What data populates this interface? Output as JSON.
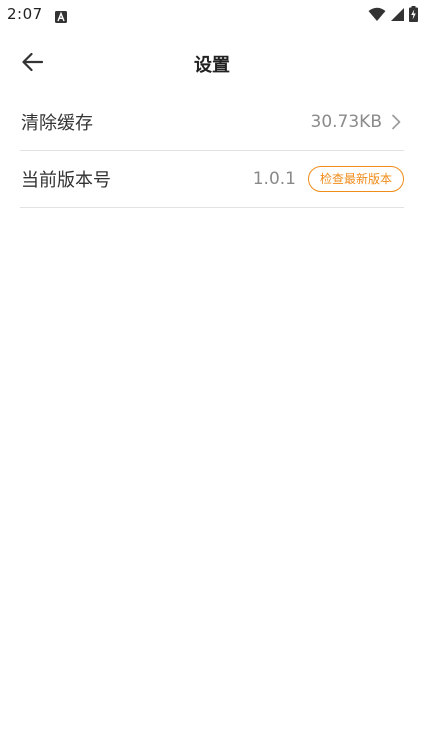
{
  "status_bar": {
    "time": "2:07",
    "icons": [
      "a-notification-icon",
      "wifi-icon",
      "signal-icon",
      "battery-charging-icon"
    ]
  },
  "header": {
    "title": "设置",
    "back_icon": "arrow-left-icon"
  },
  "settings": {
    "clear_cache": {
      "label": "清除缓存",
      "value": "30.73KB",
      "icon": "chevron-right-icon"
    },
    "version": {
      "label": "当前版本号",
      "value": "1.0.1",
      "check_button_label": "检查最新版本"
    }
  },
  "colors": {
    "accent": "#f08c1a",
    "text_primary": "#333333",
    "text_secondary": "#8a8a8a",
    "divider": "#e2e2e2"
  }
}
